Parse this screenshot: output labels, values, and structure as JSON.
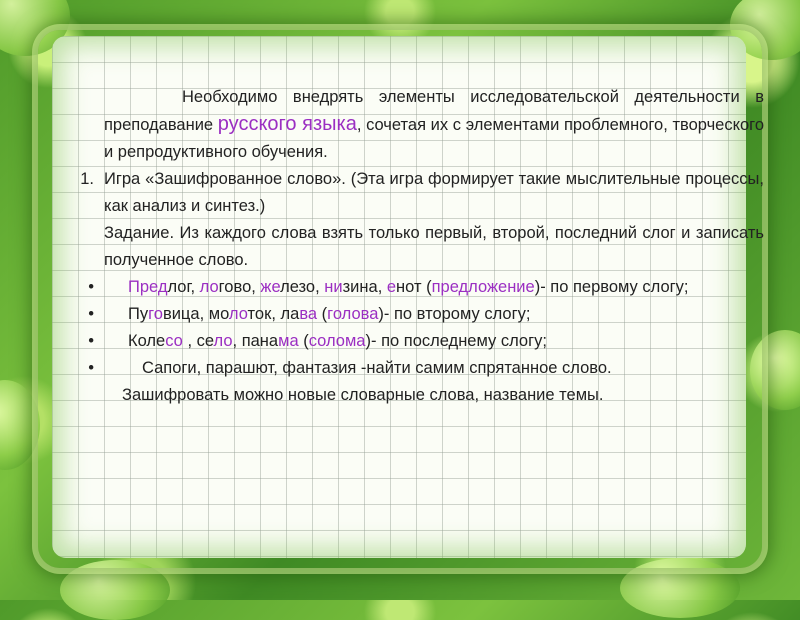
{
  "intro": {
    "part1": "Необходимо внедрять элементы исследовательской деятельности в преподавание ",
    "highlight": "русского языка",
    "part2": ", сочетая их с элементами проблемного, творческого и репродуктивного обучения."
  },
  "item1": {
    "marker": "1.",
    "text": "Игра «Зашифрованное слово». (Эта игра формирует такие мыслительные процессы, как анализ и синтез.)",
    "task": "Задание. Из каждого слова взять только первый, второй, последний слог и записать полученное слово."
  },
  "bullet1": {
    "marker": "•",
    "words": [
      {
        "hi": "Пред",
        "rest": "лог"
      },
      {
        "hi": "ло",
        "rest": "гово"
      },
      {
        "hi": "же",
        "rest": "лезо"
      },
      {
        "hi": "ни",
        "rest": "зина"
      },
      {
        "hi": "е",
        "rest": "нот"
      }
    ],
    "answer": "предложение",
    "tail": "- по первому слогу;"
  },
  "bullet2": {
    "marker": "•",
    "w1a": "Пу",
    "w1hi": "го",
    "w1b": "вица",
    "w2a": "мо",
    "w2hi": "ло",
    "w2b": "ток",
    "w3a": "ла",
    "w3hi": "ва",
    "answer": "голова",
    "tail": "- по второму слогу;"
  },
  "bullet3": {
    "marker": "•",
    "w1a": "Коле",
    "w1hi": "со",
    "w2a": "се",
    "w2hi": "ло",
    "w3a": "пана",
    "w3hi": "ма",
    "answer": "солома",
    "tail": "- по последнему слогу;"
  },
  "bullet4": {
    "marker": "•",
    "text": "Сапоги, парашют, фантазия -найти самим спрятанное слово."
  },
  "closing": "Зашифровать можно новые словарные слова, название темы.",
  "colors": {
    "accent": "#9b2fc2",
    "text": "#222222",
    "border": "#5aa52e"
  }
}
